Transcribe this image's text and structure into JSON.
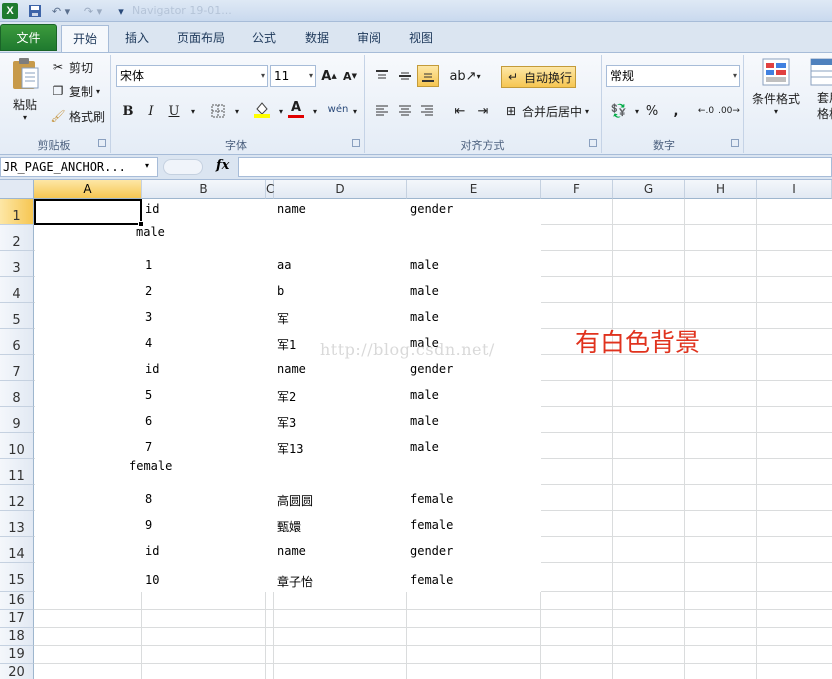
{
  "titlebar": {
    "app_icon": "X",
    "undo": "↶ ▾",
    "redo": "↷ ▾",
    "more": "▾",
    "title": "Navigator 19-01..."
  },
  "tabs": [
    "文件",
    "开始",
    "插入",
    "页面布局",
    "公式",
    "数据",
    "审阅",
    "视图"
  ],
  "ribbon": {
    "clipboard": {
      "paste": "粘贴",
      "cut": "剪切",
      "copy": "复制",
      "format_painter": "格式刷",
      "label": "剪贴板"
    },
    "font": {
      "name": "宋体",
      "size": "11",
      "grow": "A",
      "shrink": "A",
      "bold": "B",
      "italic": "I",
      "underline": "U",
      "label": "字体"
    },
    "alignment": {
      "wrap_text": "自动换行",
      "merge_center": "合并后居中",
      "label": "对齐方式"
    },
    "number": {
      "format": "常规",
      "percent": "%",
      "comma": ",",
      "label": "数字"
    },
    "styles": {
      "conditional": "条件格式",
      "table_format": "套用表格格式"
    }
  },
  "formula_bar": {
    "name_box": "JR_PAGE_ANCHOR...",
    "fx": "fx",
    "value": ""
  },
  "grid": {
    "columns": [
      "A",
      "B",
      "C",
      "D",
      "E",
      "F",
      "G",
      "H",
      "I"
    ],
    "rows": [
      "1",
      "2",
      "3",
      "4",
      "5",
      "6",
      "7",
      "8",
      "9",
      "10",
      "11",
      "12",
      "13",
      "14",
      "15",
      "16",
      "17",
      "18",
      "19",
      "20"
    ],
    "cells": [
      [
        "id",
        "name",
        "gender"
      ],
      [
        "male"
      ],
      [
        "1",
        "aa",
        "male"
      ],
      [
        "2",
        "b",
        "male"
      ],
      [
        "3",
        "军",
        "male"
      ],
      [
        "4",
        "军1",
        "male"
      ],
      [
        "id",
        "name",
        "gender"
      ],
      [
        "5",
        "军2",
        "male"
      ],
      [
        "6",
        "军3",
        "male"
      ],
      [
        "7",
        "军13",
        "male"
      ],
      [
        "female"
      ],
      [
        "8",
        "高圆圆",
        "female"
      ],
      [
        "9",
        "甄嬛",
        "female"
      ],
      [
        "id",
        "name",
        "gender"
      ],
      [
        "10",
        "章子怡",
        "female"
      ]
    ]
  },
  "watermark": "http://blog.csdn.net/",
  "annotation": "有白色背景"
}
